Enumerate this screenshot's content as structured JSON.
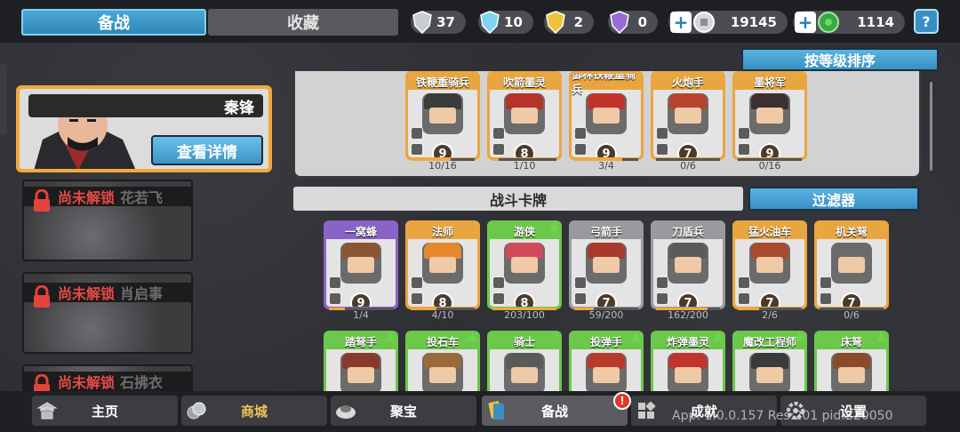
{
  "tabs": {
    "active": "备战",
    "inactive": "收藏"
  },
  "resources": [
    {
      "icon": "silver-shield-icon",
      "value": "37",
      "color": "#c9cdd4"
    },
    {
      "icon": "crystal-shield-icon",
      "value": "10",
      "color": "#7fd3f2"
    },
    {
      "icon": "gold-shield-icon",
      "value": "2",
      "color": "#f2c23a"
    },
    {
      "icon": "purple-shield-icon",
      "value": "0",
      "color": "#9a6bd8"
    }
  ],
  "currency": [
    {
      "icon": "silver-coin-icon",
      "value": "19145"
    },
    {
      "icon": "green-gem-icon",
      "value": "1114"
    }
  ],
  "help": "?",
  "hero": {
    "name": "秦锋",
    "detail_button": "查看详情"
  },
  "locked_heroes": [
    {
      "status": "尚未解锁",
      "name": "花若飞"
    },
    {
      "status": "尚未解锁",
      "name": "肖启事"
    },
    {
      "status": "尚未解锁",
      "name": "石拂衣"
    }
  ],
  "sort_button": "按等级排序",
  "deck_cards": [
    {
      "name": "铁鞭重骑兵",
      "cost": "9",
      "count": "10/16",
      "frame": "#e9a640",
      "hat": "#3b3b3b",
      "progress": 0.62
    },
    {
      "name": "吹箭墨灵",
      "cost": "8",
      "count": "1/10",
      "frame": "#e9a640",
      "hat": "#b5332a",
      "progress": 0.1
    },
    {
      "name": "御林铁鞭重骑兵",
      "cost": "9",
      "count": "3/4",
      "frame": "#e9a640",
      "hat": "#c2332c",
      "progress": 0.75
    },
    {
      "name": "火炮手",
      "cost": "7",
      "count": "0/6",
      "frame": "#e9a640",
      "hat": "#b8442e",
      "progress": 0
    },
    {
      "name": "墨将军",
      "cost": "9",
      "count": "0/16",
      "frame": "#e9a640",
      "hat": "#3b2f2f",
      "progress": 0
    }
  ],
  "section_title": "战斗卡牌",
  "filter_button": "过滤器",
  "battle_cards_row1": [
    {
      "name": "一窝蜂",
      "cost": "9",
      "count": "1/4",
      "frame": "#8a63c9",
      "hat": "#8a5532",
      "progress": 0.25,
      "upgrade": false
    },
    {
      "name": "法师",
      "cost": "8",
      "count": "4/10",
      "frame": "#e9a640",
      "hat": "#e48a2c",
      "progress": 0.4,
      "upgrade": false
    },
    {
      "name": "游侠",
      "cost": "8",
      "count": "203/100",
      "frame": "#6cc84a",
      "hat": "#d24a5a",
      "progress": 1,
      "upgrade": true
    },
    {
      "name": "弓箭手",
      "cost": "7",
      "count": "59/200",
      "frame": "#9a9a9e",
      "hat": "#a83a2c",
      "progress": 0.3,
      "upgrade": false
    },
    {
      "name": "刀盾兵",
      "cost": "7",
      "count": "162/200",
      "frame": "#9a9a9e",
      "hat": "#5a5a5a",
      "progress": 0.81,
      "upgrade": false
    },
    {
      "name": "猛火油车",
      "cost": "7",
      "count": "2/6",
      "frame": "#e9a640",
      "hat": "#a84a2c",
      "progress": 0.33,
      "upgrade": false
    },
    {
      "name": "机关弩",
      "cost": "7",
      "count": "0/6",
      "frame": "#e9a640",
      "hat": "#6a6a6a",
      "progress": 0,
      "upgrade": false
    }
  ],
  "battle_cards_row2": [
    {
      "name": "踏弩手",
      "frame": "#6cc84a",
      "hat": "#8a3a2c",
      "upgrade": true
    },
    {
      "name": "投石车",
      "frame": "#6cc84a",
      "hat": "#9a6a3a",
      "upgrade": true
    },
    {
      "name": "骑士",
      "frame": "#6cc84a",
      "hat": "#5a5a5a",
      "upgrade": false
    },
    {
      "name": "投弹手",
      "frame": "#6cc84a",
      "hat": "#b83a2c",
      "upgrade": true
    },
    {
      "name": "炸弹墨灵",
      "frame": "#6cc84a",
      "hat": "#c2332c",
      "upgrade": true
    },
    {
      "name": "魔改工程师",
      "frame": "#6cc84a",
      "hat": "#3a3a3a",
      "upgrade": true
    },
    {
      "name": "床弩",
      "frame": "#6cc84a",
      "hat": "#8a4a2c",
      "upgrade": true
    }
  ],
  "nav": [
    {
      "label": "主页",
      "icon": "pagoda-icon"
    },
    {
      "label": "商城",
      "icon": "coins-icon"
    },
    {
      "label": "聚宝",
      "icon": "treasure-bowl-icon"
    },
    {
      "label": "备战",
      "icon": "card-icon",
      "badge": "!"
    },
    {
      "label": "成就",
      "icon": "grid-icon"
    },
    {
      "label": "设置",
      "icon": "gear-icon"
    }
  ],
  "version": "App: 1.0.0.157 Res:201 pid:220050"
}
